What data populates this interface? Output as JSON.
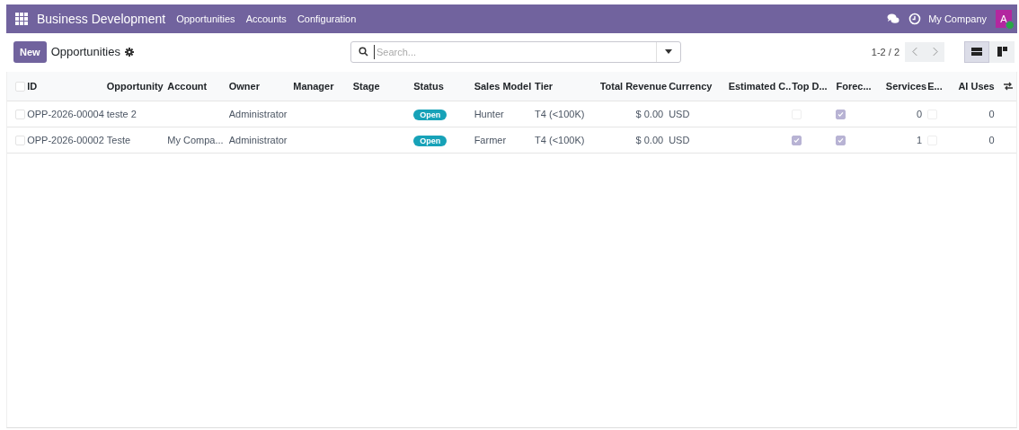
{
  "navbar": {
    "app": "Business Development",
    "menu": [
      "Opportunities",
      "Accounts",
      "Configuration"
    ],
    "company": "My Company",
    "avatar": "A"
  },
  "control_panel": {
    "new_button": "New",
    "title": "Opportunities",
    "search": {
      "placeholder": "Search..."
    },
    "pager": "1-2 / 2",
    "views": [
      {
        "kind": "list",
        "selected": true
      },
      {
        "kind": "kanban",
        "selected": false
      }
    ]
  },
  "table": {
    "select_all": {
      "checked": false
    },
    "columns": [
      {
        "label": "ID",
        "kind": "text"
      },
      {
        "label": "Opportunity",
        "kind": "text"
      },
      {
        "label": "Account",
        "kind": "text"
      },
      {
        "label": "Owner",
        "kind": "text"
      },
      {
        "label": "Manager",
        "kind": "text"
      },
      {
        "label": "Stage",
        "kind": "text"
      },
      {
        "label": "Status",
        "kind": "status"
      },
      {
        "label": "Sales Model",
        "kind": "text"
      },
      {
        "label": "Tier",
        "kind": "text"
      },
      {
        "label": "Total Revenue",
        "kind": "number"
      },
      {
        "label": "Currency",
        "kind": "text"
      },
      {
        "label": "Estimated C...",
        "kind": "text"
      },
      {
        "label": "Top D...",
        "kind": "check"
      },
      {
        "label": "Forec...",
        "kind": "check"
      },
      {
        "label": "Services",
        "kind": "number"
      },
      {
        "label": "E...",
        "kind": "check"
      },
      {
        "label": "AI Uses",
        "kind": "number"
      }
    ],
    "rows": [
      {
        "selected": false,
        "cells": [
          "OPP-2026-00004",
          "teste 2",
          null,
          "Administrator",
          null,
          null,
          "Open",
          "Hunter",
          "T4 (<100K)",
          "$ 0.00",
          "USD",
          null,
          false,
          true,
          "0",
          false,
          "0"
        ]
      },
      {
        "selected": false,
        "cells": [
          "OPP-2026-00002",
          "Teste",
          "My Compa...",
          "Administrator",
          null,
          null,
          "Open",
          "Farmer",
          "T4 (<100K)",
          "$ 0.00",
          "USD",
          null,
          true,
          true,
          "1",
          false,
          "0"
        ]
      }
    ]
  }
}
